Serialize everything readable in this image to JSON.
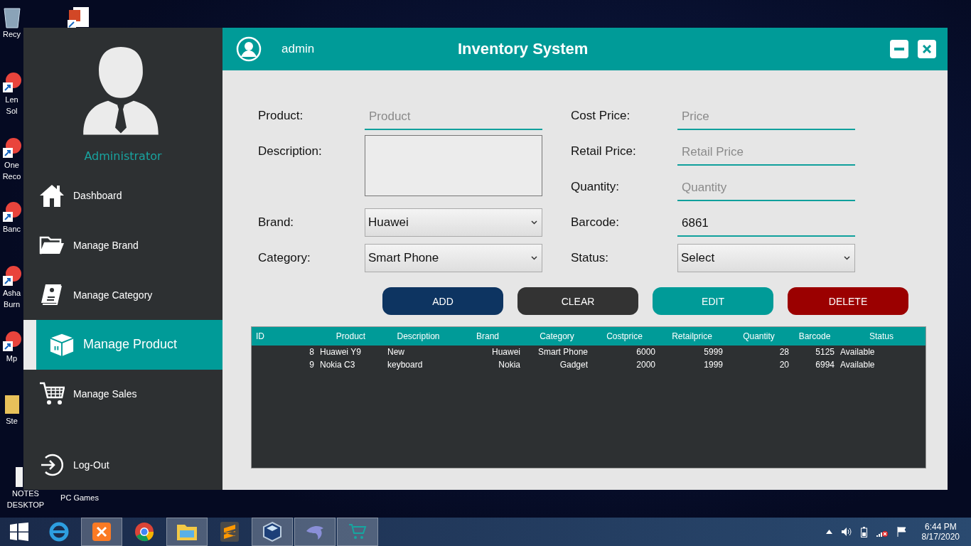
{
  "desktop_icons": [
    {
      "kind": "recycle",
      "lines": [
        "Recy"
      ]
    },
    {
      "kind": "shortcut",
      "lines": [
        "Len",
        "Sol"
      ]
    },
    {
      "kind": "shortcut",
      "lines": [
        "One",
        "Reco"
      ]
    },
    {
      "kind": "shortcut",
      "lines": [
        "Banc"
      ]
    },
    {
      "kind": "shortcut",
      "lines": [
        "Asha",
        "Burn"
      ]
    },
    {
      "kind": "shortcut",
      "lines": [
        "Mp"
      ]
    },
    {
      "kind": "folder",
      "lines": [
        "Ste"
      ]
    },
    {
      "kind": "notes",
      "lines": [
        "NOTES",
        "DESKTOP"
      ]
    },
    {
      "kind": "slides"
    },
    {
      "kind": "none",
      "lines": [
        "PC Games"
      ]
    }
  ],
  "sidebar": {
    "role": "Administrator",
    "items": [
      {
        "label": "Dashboard",
        "selected": false
      },
      {
        "label": "Manage Brand",
        "selected": false
      },
      {
        "label": "Manage Category",
        "selected": false
      },
      {
        "label": "Manage Product",
        "selected": true
      },
      {
        "label": "Manage Sales",
        "selected": false
      }
    ],
    "logout": "Log-Out"
  },
  "header": {
    "user": "admin",
    "title": "Inventory System"
  },
  "form": {
    "left": [
      {
        "label": "Product:",
        "kind": "text",
        "placeholder": "Product"
      },
      {
        "label": "Description:",
        "kind": "textarea"
      },
      {
        "label": "Brand:",
        "kind": "select",
        "value": "Huawei"
      },
      {
        "label": "Category:",
        "kind": "select",
        "value": "Smart Phone"
      }
    ],
    "right": [
      {
        "label": "Cost Price:",
        "kind": "text",
        "placeholder": "Price"
      },
      {
        "label": "Retail Price:",
        "kind": "text",
        "placeholder": "Retail Price"
      },
      {
        "label": "Quantity:",
        "kind": "text",
        "placeholder": "Quantity"
      },
      {
        "label": "Barcode:",
        "kind": "text",
        "value": "6861"
      },
      {
        "label": "Status:",
        "kind": "select",
        "value": "Select"
      }
    ]
  },
  "buttons": [
    {
      "label": "ADD",
      "color": "#0d3461"
    },
    {
      "label": "CLEAR",
      "color": "#333333"
    },
    {
      "label": "EDIT",
      "color": "#009b98"
    },
    {
      "label": "DELETE",
      "color": "#9b0000"
    }
  ],
  "table": {
    "columns": [
      "ID",
      "Product",
      "Description",
      "Brand",
      "Category",
      "Costprice",
      "Retailprice",
      "Quantity",
      "Barcode",
      "Status"
    ],
    "rows": [
      [
        "8",
        "Huawei Y9",
        "New",
        "Huawei",
        "Smart Phone",
        "6000",
        "5999",
        "28",
        "5125",
        "Available"
      ],
      [
        "9",
        "Nokia C3",
        "keyboard",
        "Nokia",
        "Gadget",
        "2000",
        "1999",
        "20",
        "6994",
        "Available"
      ]
    ]
  },
  "taskbar": {
    "apps": [
      {
        "kind": "ie",
        "selected": false
      },
      {
        "kind": "xampp",
        "selected": true
      },
      {
        "kind": "chrome",
        "selected": false
      },
      {
        "kind": "explorer",
        "selected": true
      },
      {
        "kind": "sublime",
        "selected": false
      },
      {
        "kind": "cube",
        "selected": true
      },
      {
        "kind": "dolphin",
        "selected": true
      },
      {
        "kind": "cart",
        "selected": true
      }
    ],
    "time": "6:44 PM",
    "date": "8/17/2020"
  }
}
